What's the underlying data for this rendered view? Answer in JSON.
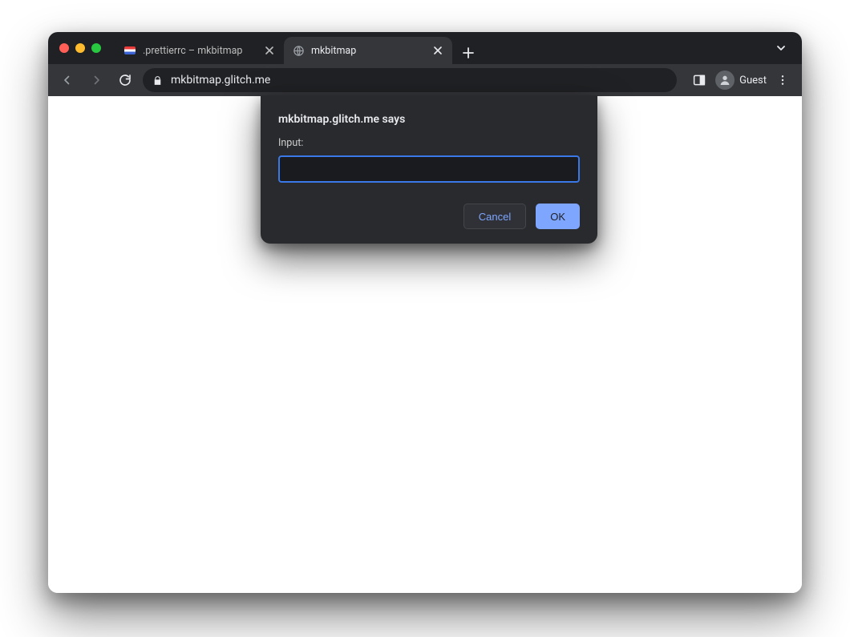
{
  "tabs": [
    {
      "title": ".prettierrc – mkbitmap",
      "active": false
    },
    {
      "title": "mkbitmap",
      "active": true
    }
  ],
  "omnibox": {
    "url": "mkbitmap.glitch.me"
  },
  "profile": {
    "label": "Guest"
  },
  "dialog": {
    "title": "mkbitmap.glitch.me says",
    "label": "Input:",
    "value": "",
    "cancel": "Cancel",
    "ok": "OK"
  }
}
